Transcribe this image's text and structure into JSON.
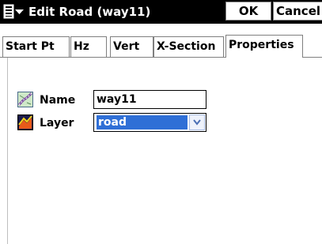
{
  "titlebar": {
    "title": "Edit Road (way11)",
    "ok_label": "OK",
    "cancel_label": "Cancel",
    "menu_icon": "menu-dropdown-icon"
  },
  "tabs": [
    {
      "label": "Start Pt",
      "active": false
    },
    {
      "label": "Hz",
      "active": false
    },
    {
      "label": "Vert",
      "active": false
    },
    {
      "label": "X-Section",
      "active": false
    },
    {
      "label": "Properties",
      "active": true
    }
  ],
  "form": {
    "name": {
      "label": "Name",
      "value": "way11",
      "icon": "road-map-icon"
    },
    "layer": {
      "label": "Layer",
      "value": "road",
      "icon": "layer-icon"
    }
  },
  "colors": {
    "titlebar_bg": "#000000",
    "selection": "#2f6fd6"
  }
}
